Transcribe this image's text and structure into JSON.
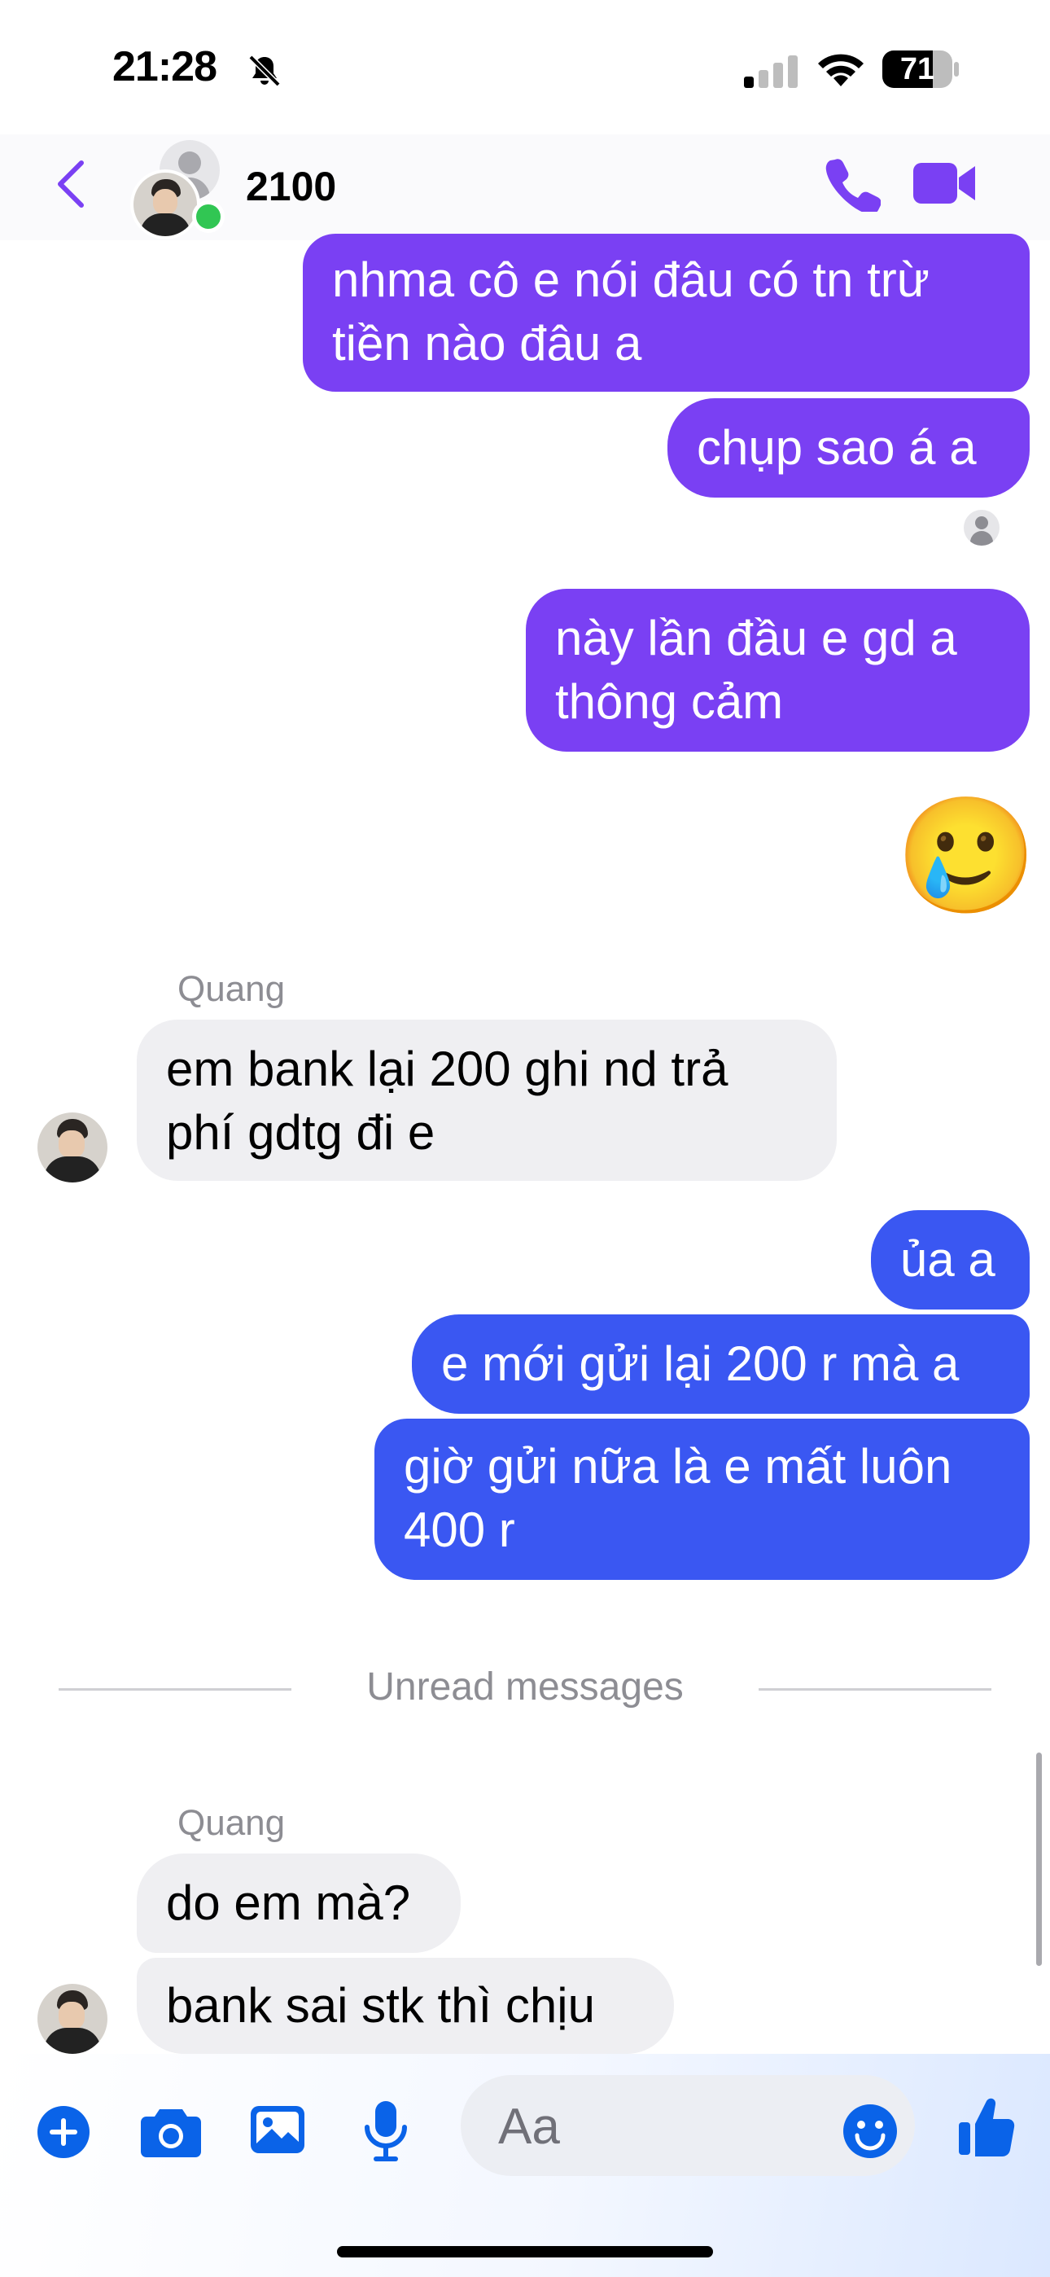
{
  "status_bar": {
    "time": "21:28",
    "battery": "71"
  },
  "header": {
    "contact_name": "2100"
  },
  "messages": {
    "m1": "nhma cô e nói đâu có tn trừ\ntiền nào đâu a",
    "m2": "chụp sao á a",
    "m3": "này lần đầu e gd a\nthông cảm",
    "m4_emoji": "🥲",
    "sender1": "Quang",
    "m5": "em bank lại 200 ghi nd trả\nphí gdtg đi e",
    "m6": "ủa a",
    "m7": "e mới gửi lại 200 r mà a",
    "m8": "giờ gửi nữa là e mất luôn\n400 r",
    "unread": "Unread messages",
    "sender2": "Quang",
    "m9": "do em mà?",
    "m10": "bank sai stk thì chịu"
  },
  "composer": {
    "placeholder": "Aa"
  },
  "colors": {
    "accent": "#7a40f3",
    "outgoing_purple": "#7a40f3",
    "outgoing_blue": "#3a57f2",
    "incoming": "#efeff2",
    "online": "#31c653"
  },
  "icons": [
    "back-icon",
    "phone-icon",
    "video-icon",
    "plus-icon",
    "camera-icon",
    "gallery-icon",
    "mic-icon",
    "emoji-icon",
    "like-icon",
    "mute-icon",
    "signal-icon",
    "wifi-icon",
    "battery-icon"
  ]
}
